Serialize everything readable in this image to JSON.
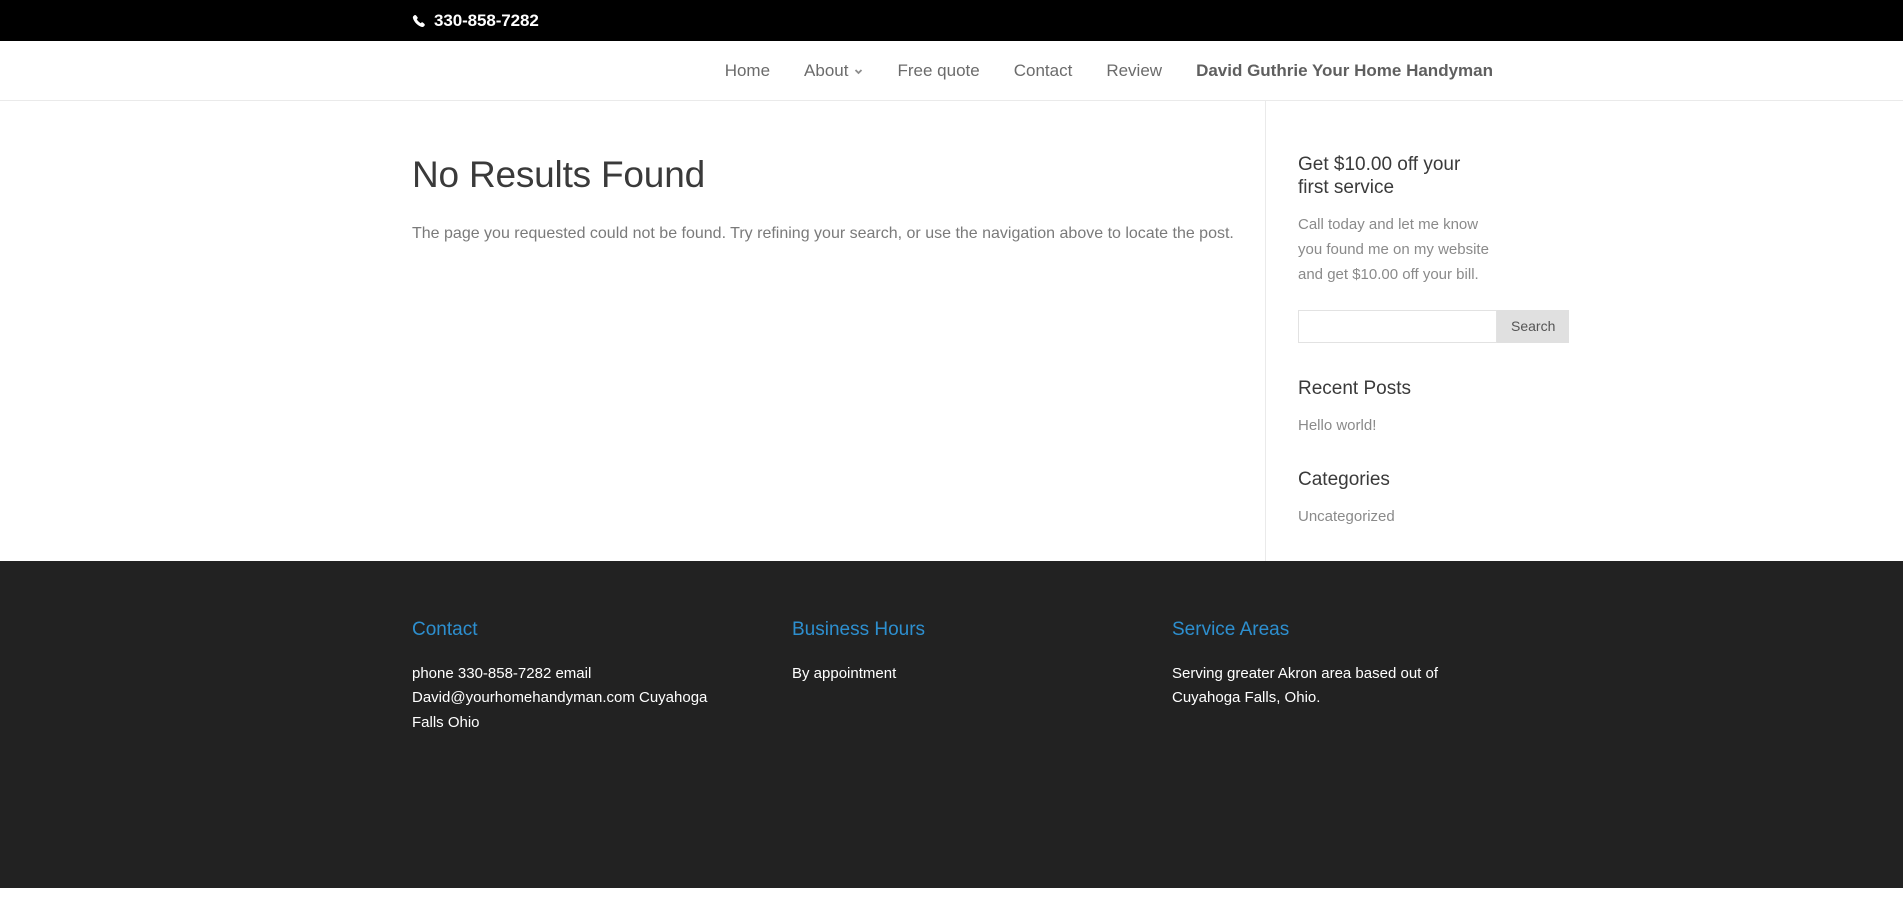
{
  "topbar": {
    "phone_icon": "phone-icon",
    "phone": "330-858-7282"
  },
  "nav": {
    "items": [
      {
        "label": "Home",
        "has_dropdown": false
      },
      {
        "label": "About",
        "has_dropdown": true,
        "dropdown_icon": "chevron-down-icon"
      },
      {
        "label": "Free quote",
        "has_dropdown": false
      },
      {
        "label": "Contact",
        "has_dropdown": false
      },
      {
        "label": "Review",
        "has_dropdown": false
      },
      {
        "label": "David Guthrie Your Home Handyman",
        "has_dropdown": false
      }
    ]
  },
  "main": {
    "title": "No Results Found",
    "body": "The page you requested could not be found. Try refining your search, or use the navigation above to locate the post."
  },
  "sidebar": {
    "promo": {
      "title": "Get $10.00 off your first service",
      "text": "Call today and let me know you found me on my website and get $10.00 off your bill."
    },
    "search": {
      "value": "",
      "placeholder": "",
      "button_label": "Search"
    },
    "recent_posts": {
      "title": "Recent Posts",
      "items": [
        "Hello world!"
      ]
    },
    "categories": {
      "title": "Categories",
      "items": [
        "Uncategorized"
      ]
    }
  },
  "footer": {
    "columns": [
      {
        "heading": "Contact",
        "text": "phone 330-858-7282 email David@yourhomehandyman.com Cuyahoga Falls Ohio"
      },
      {
        "heading": "Business Hours",
        "text": "By appointment"
      },
      {
        "heading": "Service Areas",
        "text": "Serving greater Akron area based out of Cuyahoga Falls, Ohio."
      }
    ]
  },
  "colors": {
    "topbar_bg": "#000000",
    "footer_bg": "#222222",
    "accent_blue": "#2d8fcf",
    "nav_text": "#6b6b6b",
    "body_text": "#7a7a7a",
    "heading_text": "#3a3a3a",
    "search_button_bg": "#e0e0e0"
  }
}
